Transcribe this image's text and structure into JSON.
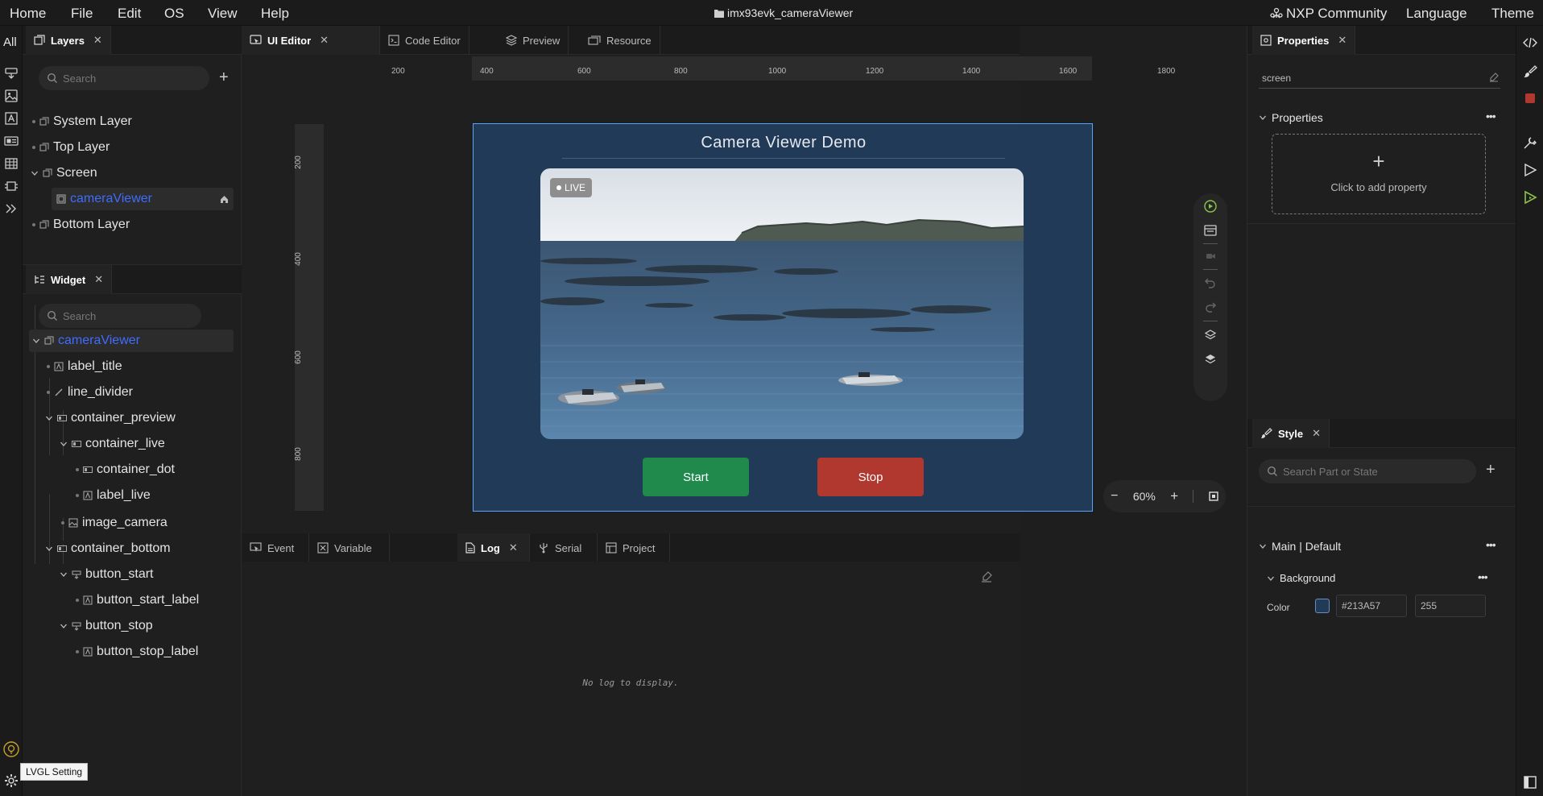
{
  "menubar": {
    "items": [
      "Home",
      "File",
      "Edit",
      "OS",
      "View",
      "Help"
    ],
    "window_title": "imx93evk_cameraViewer",
    "right_items": [
      "NXP Community",
      "Language",
      "Theme"
    ]
  },
  "iconbar": {
    "all_label": "All"
  },
  "layers": {
    "tab_label": "Layers",
    "search_placeholder": "Search",
    "items": [
      "System Layer",
      "Top Layer",
      "Screen",
      "cameraViewer",
      "Bottom Layer"
    ]
  },
  "widget": {
    "tab_label": "Widget",
    "search_placeholder": "Search",
    "items": [
      "cameraViewer",
      "label_title",
      "line_divider",
      "container_preview",
      "container_live",
      "container_dot",
      "label_live",
      "image_camera",
      "container_bottom",
      "button_start",
      "button_start_label",
      "button_stop",
      "button_stop_label"
    ]
  },
  "editor_tabs": [
    "UI Editor",
    "Code Editor",
    "Preview",
    "Resource"
  ],
  "ruler": {
    "x": [
      "200",
      "400",
      "600",
      "800",
      "1000",
      "1200",
      "1400",
      "1600",
      "1800"
    ],
    "y": [
      "200",
      "400",
      "600",
      "800"
    ]
  },
  "screen": {
    "title": "Camera Viewer Demo",
    "live_label": "LIVE",
    "start_label": "Start",
    "stop_label": "Stop",
    "bg_color": "#213A57",
    "start_color": "#1f8a4c",
    "stop_color": "#b0382e"
  },
  "zoom": {
    "level": "60%",
    "minus": "−",
    "plus": "+"
  },
  "bottom_tabs": [
    "Event",
    "Variable",
    "Log",
    "Serial",
    "Project"
  ],
  "log": {
    "empty_text": "No log to display."
  },
  "properties": {
    "tab_label": "Properties",
    "target": "screen",
    "section": "Properties",
    "add_plus": "+",
    "add_label": "Click to add property"
  },
  "style": {
    "tab_label": "Style",
    "search_placeholder": "Search Part or State",
    "section": "Main | Default",
    "subsection": "Background",
    "color_label": "Color",
    "color_hex": "#213A57",
    "opacity": "255"
  },
  "tooltip": "LVGL Setting"
}
